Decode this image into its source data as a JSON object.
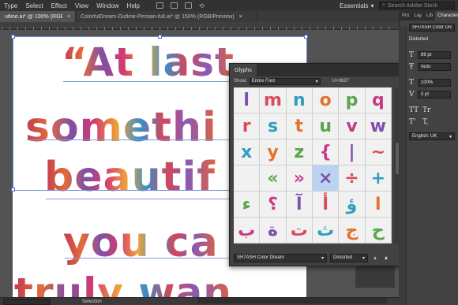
{
  "menu": {
    "items": [
      "Type",
      "Select",
      "Effect",
      "View",
      "Window",
      "Help"
    ],
    "workspace": "Essentials",
    "search_placeholder": "Search Adobe Stock"
  },
  "tabs": [
    {
      "label": "utline.ai* @ 100% (RGB/Preview)",
      "close": "×"
    },
    {
      "label": "ColorfulDream-Outline-Persian-full.ai* @ 150% (RGB/Preview)",
      "close": "×"
    }
  ],
  "artwork": {
    "lines": [
      "“At last",
      "somethi",
      "beautif",
      "you ca",
      "truly wan"
    ]
  },
  "glyphs_panel": {
    "title": "Glyphs",
    "show_label": "Show:",
    "show_value": "Entire Font",
    "code": "U+0627",
    "glyph_rows": [
      [
        "l",
        "m",
        "n",
        "o",
        "p",
        "q"
      ],
      [
        "r",
        "s",
        "t",
        "u",
        "v",
        "w"
      ],
      [
        "x",
        "y",
        "z",
        "{",
        "|",
        "~"
      ],
      [
        "",
        "«",
        "»",
        "×",
        "÷",
        "+"
      ],
      [
        "ء",
        "؟",
        "آ",
        "أ",
        "ؤ",
        "ا"
      ],
      [
        "ب",
        "ة",
        "ت",
        "ث",
        "ج",
        "ح"
      ]
    ],
    "font": "SH7ASH Color Dream",
    "style": "Distorted"
  },
  "right_panel": {
    "tabs": [
      "Pro",
      "Lay",
      "Lib",
      "Character"
    ],
    "font": "SH7ASH Color Dream",
    "style": "Distorted",
    "size": "89 pt",
    "leading": "Auto",
    "vscale": "100%",
    "tracking": "0 pt",
    "language": "English: UK",
    "glyph_tt": "TT",
    "glyph_tr": "Tr",
    "glyph_t1": "T'",
    "glyph_t2": "T,"
  },
  "status": {
    "tool": "Selection"
  },
  "colors": {
    "chrome_dark": "#323232",
    "panel": "#424242",
    "canvas": "#535353",
    "selection": "#6f8ad6"
  }
}
